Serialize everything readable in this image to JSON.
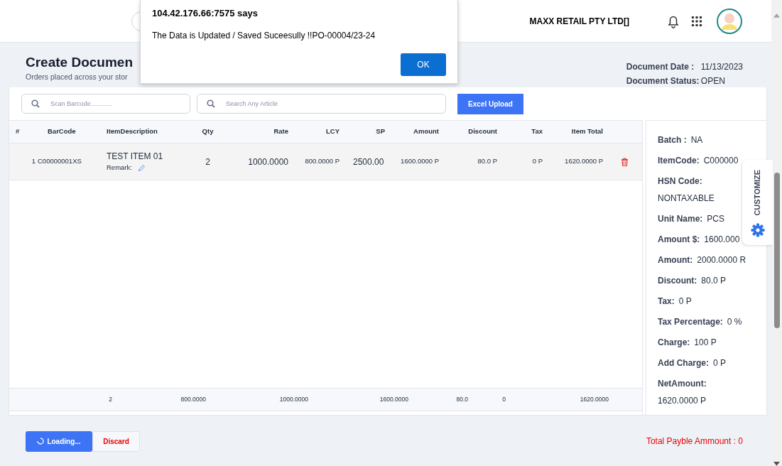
{
  "header": {
    "company": "MAXX RETAIL PTY LTD[]"
  },
  "page": {
    "title": "Create Documen",
    "subtitle": "Orders placed across your stor",
    "meta": [
      {
        "label": "Document Date :",
        "value": "11/13/2023"
      },
      {
        "label": "Document Status:",
        "value": "OPEN"
      }
    ]
  },
  "toolbar": {
    "barcode": {
      "placeholder": "Scan Barcode............"
    },
    "search": {
      "placeholder": "Search Any Article"
    },
    "upload_button": "Excel Upload"
  },
  "table": {
    "columns": [
      "#",
      "BarCode",
      "ItemDescription",
      "Qty",
      "Rate",
      "LCY",
      "SP",
      "Amount",
      "Discount",
      "Tax",
      "Item Total"
    ],
    "rows": [
      {
        "index": "1",
        "barcode": "C00000001XS",
        "description": "TEST ITEM 01",
        "remark_label": "Remark:",
        "qty": "2",
        "rate": "1000.0000",
        "lcy": "800.0000 P",
        "sp": "2500.00",
        "amount": "1600.0000 P",
        "discount": "80.0 P",
        "tax": "0 P",
        "item_total": "1620.0000 P"
      }
    ],
    "totals": [
      "2",
      "800.0000",
      "1000.0000",
      "1600.0000",
      "80.0",
      "0",
      "1620.0000"
    ]
  },
  "details": [
    {
      "label": "Batch :",
      "value": "NA",
      "stacked": false
    },
    {
      "label": "ItemCode:",
      "value": "C000000",
      "stacked": false
    },
    {
      "label": "HSN Code:",
      "value": "NONTAXABLE",
      "stacked": true
    },
    {
      "label": "Unit Name:",
      "value": "PCS",
      "stacked": false
    },
    {
      "label": "Amount $:",
      "value": "1600.000",
      "stacked": false
    },
    {
      "label": "Amount:",
      "value": "2000.0000 R",
      "stacked": false
    },
    {
      "label": "Discount:",
      "value": "80.0 P",
      "stacked": false
    },
    {
      "label": "Tax:",
      "value": "0 P",
      "stacked": false
    },
    {
      "label": "Tax Percentage:",
      "value": "0 %",
      "stacked": false
    },
    {
      "label": "Charge:",
      "value": "100 P",
      "stacked": false
    },
    {
      "label": "Add Charge:",
      "value": "0 P",
      "stacked": false
    },
    {
      "label": "NetAmount:",
      "value": "1620.0000 P",
      "stacked": true
    }
  ],
  "customize_tab": "CUSTOMIZE",
  "footer": {
    "save_button": "Loading...",
    "loading": true,
    "discard_button": "Discard",
    "total": "Total Payble Ammount : 0"
  },
  "dialog": {
    "title": "104.42.176.66:7575 says",
    "message": "The Data is Updated / Saved Suceesully !!PO-00004/23-24",
    "ok_button": "OK"
  }
}
